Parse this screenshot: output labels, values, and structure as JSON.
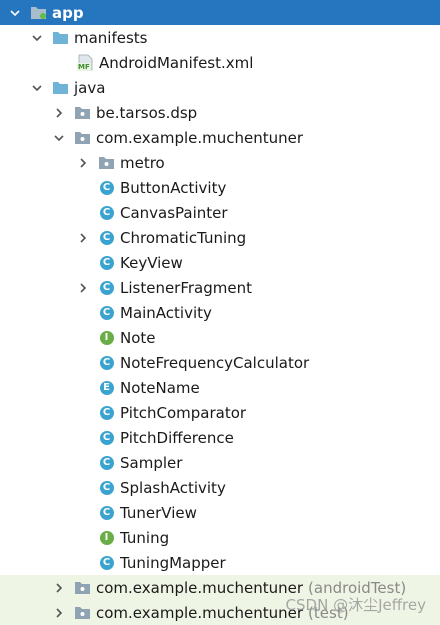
{
  "tree": {
    "app": "app",
    "manifests": "manifests",
    "manifest_file": "AndroidManifest.xml",
    "manifest_badge": "MF",
    "java": "java",
    "pkg_tarsos": "be.tarsos.dsp",
    "pkg_main": "com.example.muchentuner",
    "pkg_metro": "metro",
    "classes": {
      "button_activity": "ButtonActivity",
      "canvas_painter": "CanvasPainter",
      "chromatic_tuning": "ChromaticTuning",
      "key_view": "KeyView",
      "listener_fragment": "ListenerFragment",
      "main_activity": "MainActivity",
      "note": "Note",
      "note_frequency_calculator": "NoteFrequencyCalculator",
      "note_name": "NoteName",
      "pitch_comparator": "PitchComparator",
      "pitch_difference": "PitchDifference",
      "sampler": "Sampler",
      "splash_activity": "SplashActivity",
      "tuner_view": "TunerView",
      "tuning": "Tuning",
      "tuning_mapper": "TuningMapper"
    },
    "badges": {
      "class": "C",
      "interface": "I",
      "enum": "E"
    },
    "pkg_android_test": "com.example.muchentuner",
    "pkg_android_test_suffix": "(androidTest)",
    "pkg_test": "com.example.muchentuner",
    "pkg_test_suffix": "(test)"
  },
  "watermark": "CSDN @沐尘Jeffrey",
  "colors": {
    "selection": "#2675bf",
    "class_icon": "#3ba3cf",
    "interface_icon": "#6aac45",
    "folder": "#8fa3b3",
    "test_row": "#eef5e4"
  }
}
